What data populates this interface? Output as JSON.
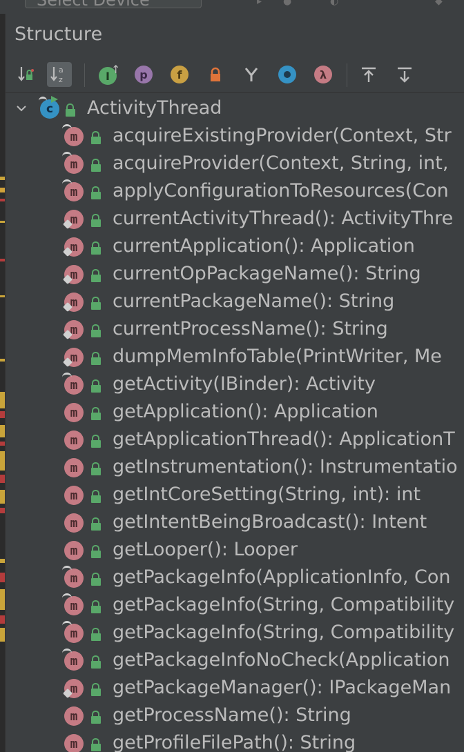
{
  "topbar": {
    "device_select_placeholder": "Select Device"
  },
  "panel": {
    "title": "Structure",
    "toolbar": {
      "items": [
        {
          "name": "sort-by-visibility-icon",
          "glyph": "↓≡"
        },
        {
          "name": "sort-alphabetically-icon",
          "glyph": "a↓z"
        },
        {
          "name": "show-inherited-icon",
          "glyph": "I"
        },
        {
          "name": "show-properties-icon",
          "glyph": "p"
        },
        {
          "name": "show-fields-icon",
          "glyph": "f"
        },
        {
          "name": "show-non-public-icon",
          "glyph": "lock"
        },
        {
          "name": "show-anonymous-icon",
          "glyph": "Y"
        },
        {
          "name": "show-lambdas-icon",
          "glyph": "o"
        },
        {
          "name": "show-lambda-icon",
          "glyph": "λ"
        },
        {
          "name": "expand-all-icon",
          "glyph": "↑"
        },
        {
          "name": "collapse-all-icon",
          "glyph": "↓"
        }
      ]
    },
    "root": {
      "label": "ActivityThread"
    },
    "methods": [
      {
        "label": "acquireExistingProvider(Context, Str",
        "marker": "override"
      },
      {
        "label": "acquireProvider(Context, String, int,",
        "marker": "override"
      },
      {
        "label": "applyConfigurationToResources(Con",
        "marker": "override"
      },
      {
        "label": "currentActivityThread(): ActivityThre",
        "marker": "impl"
      },
      {
        "label": "currentApplication(): Application",
        "marker": "impl"
      },
      {
        "label": "currentOpPackageName(): String",
        "marker": "impl"
      },
      {
        "label": "currentPackageName(): String",
        "marker": "impl"
      },
      {
        "label": "currentProcessName(): String",
        "marker": "impl"
      },
      {
        "label": "dumpMemInfoTable(PrintWriter, Me",
        "marker": "impl"
      },
      {
        "label": "getActivity(IBinder): Activity",
        "marker": "override"
      },
      {
        "label": "getApplication(): Application",
        "marker": "none"
      },
      {
        "label": "getApplicationThread(): ApplicationT",
        "marker": "none"
      },
      {
        "label": "getInstrumentation(): Instrumentatio",
        "marker": "none"
      },
      {
        "label": "getIntCoreSetting(String, int): int",
        "marker": "none"
      },
      {
        "label": "getIntentBeingBroadcast(): Intent",
        "marker": "none"
      },
      {
        "label": "getLooper(): Looper",
        "marker": "none"
      },
      {
        "label": "getPackageInfo(ApplicationInfo, Con",
        "marker": "override"
      },
      {
        "label": "getPackageInfo(String, Compatibility",
        "marker": "override"
      },
      {
        "label": "getPackageInfo(String, Compatibility",
        "marker": "override"
      },
      {
        "label": "getPackageInfoNoCheck(Application",
        "marker": "override"
      },
      {
        "label": "getPackageManager(): IPackageMan",
        "marker": "impl"
      },
      {
        "label": "getProcessName(): String",
        "marker": "none"
      },
      {
        "label": "getProfileFilePath(): String",
        "marker": "none"
      }
    ]
  },
  "colors": {
    "background": "#3c3f41",
    "method_icon": "#c57b84",
    "class_icon": "#3592c4",
    "access_lock": "#59a869",
    "text": "#bbbbbb"
  }
}
